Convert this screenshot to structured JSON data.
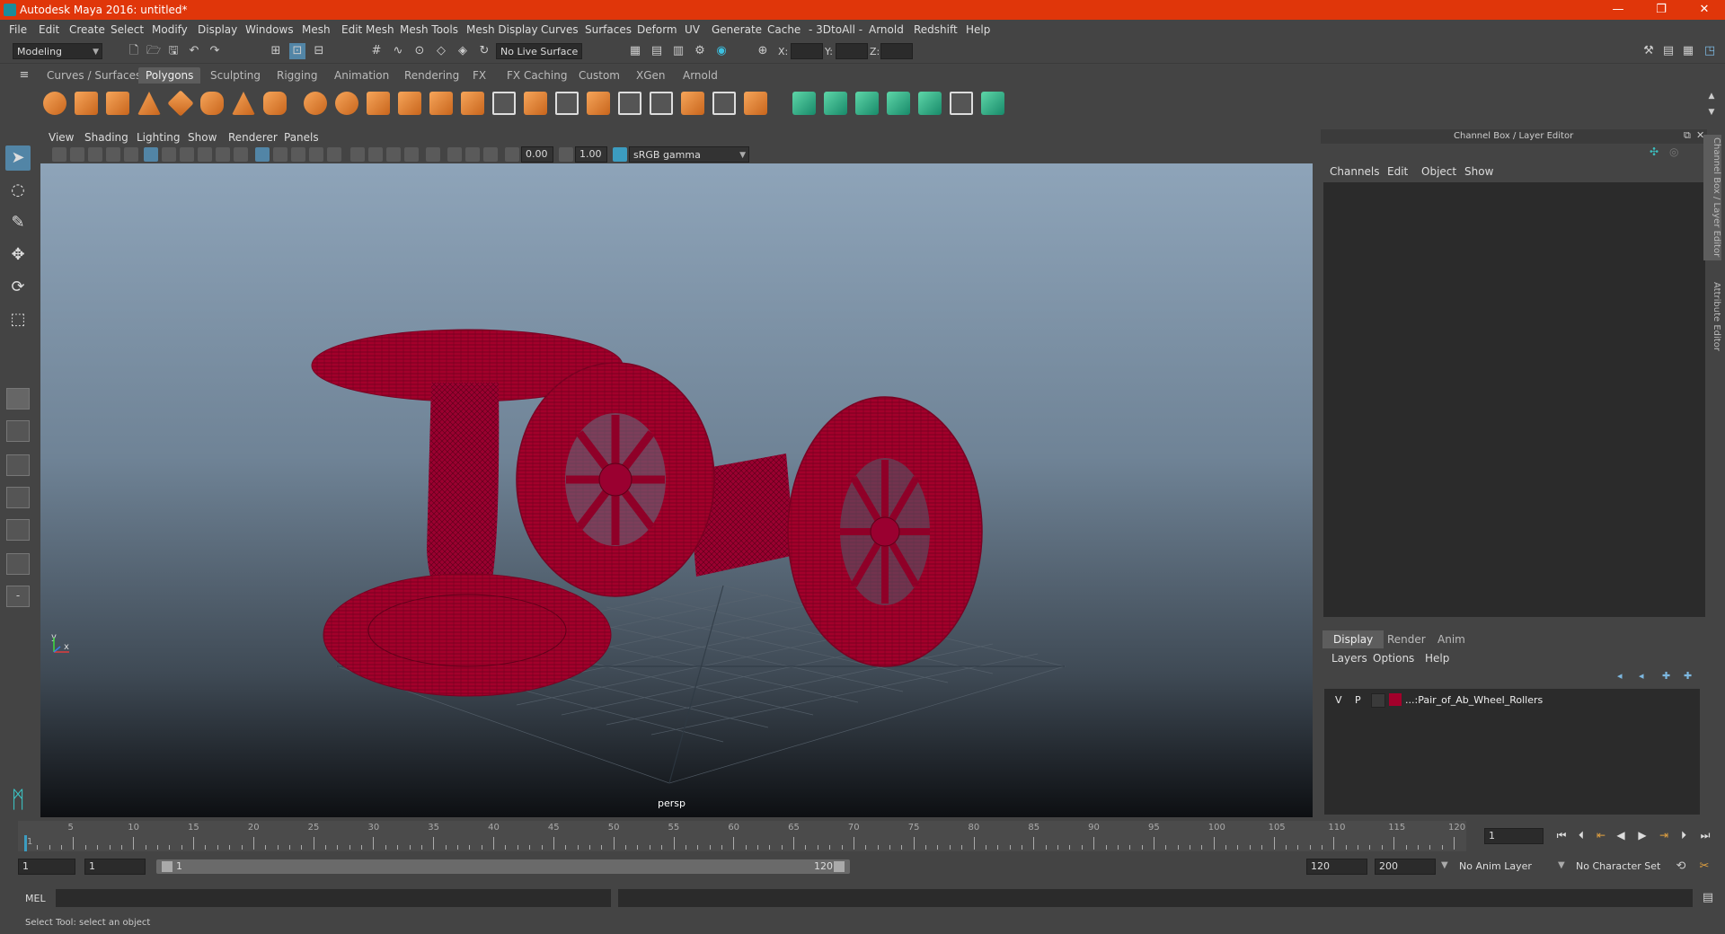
{
  "window": {
    "title": "Autodesk Maya 2016: untitled*",
    "minimize": "—",
    "maximize": "❐",
    "close": "✕"
  },
  "menus": [
    "File",
    "Edit",
    "Create",
    "Select",
    "Modify",
    "Display",
    "Windows",
    "Mesh",
    "Edit Mesh",
    "Mesh Tools",
    "Mesh Display",
    "Curves",
    "Surfaces",
    "Deform",
    "UV",
    "Generate",
    "Cache",
    "- 3DtoAll -",
    "Arnold",
    "Redshift",
    "Help"
  ],
  "statusline": {
    "mode": "Modeling",
    "live_surface": "No Live Surface",
    "x_label": "X:",
    "y_label": "Y:",
    "z_label": "Z:"
  },
  "shelf_tabs": [
    "Curves / Surfaces",
    "Polygons",
    "Sculpting",
    "Rigging",
    "Animation",
    "Rendering",
    "FX",
    "FX Caching",
    "Custom",
    "XGen",
    "Arnold"
  ],
  "active_shelf": "Polygons",
  "viewport": {
    "menus": [
      "View",
      "Shading",
      "Lighting",
      "Show",
      "Renderer",
      "Panels"
    ],
    "exposure": "0.00",
    "gamma": "1.00",
    "color_space": "sRGB gamma",
    "camera_label": "persp",
    "axis_y": "y",
    "axis_x": "x"
  },
  "channel_box": {
    "header": "Channel Box / Layer Editor",
    "menus": [
      "Channels",
      "Edit",
      "Object",
      "Show"
    ],
    "side_tabs": [
      "Channel Box / Layer Editor",
      "Attribute Editor"
    ]
  },
  "layer_editor": {
    "tabs": [
      "Display",
      "Render",
      "Anim"
    ],
    "active_tab": "Display",
    "menus": [
      "Layers",
      "Options",
      "Help"
    ],
    "layers": [
      {
        "v": "V",
        "p": "P",
        "name": "...:Pair_of_Ab_Wheel_Rollers",
        "color": "#a3002b"
      }
    ]
  },
  "time_slider": {
    "labels": [
      "1",
      "5",
      "10",
      "15",
      "20",
      "25",
      "30",
      "35",
      "40",
      "45",
      "50",
      "55",
      "60",
      "65",
      "70",
      "75",
      "80",
      "85",
      "90",
      "95",
      "100",
      "105",
      "110",
      "115",
      "120"
    ],
    "current_frame": "1"
  },
  "range_slider": {
    "start": "1",
    "playback_start": "1",
    "range_start_label": "1",
    "range_end_label": "120",
    "playback_end": "120",
    "end": "200",
    "anim_layer": "No Anim Layer",
    "character_set": "No Character Set"
  },
  "command_line": {
    "label": "MEL"
  },
  "help_line": {
    "text": "Select Tool: select an object"
  },
  "colors": {
    "title_bar": "#e0360a",
    "wireframe": "#a3002b",
    "accent": "#5285a6"
  }
}
